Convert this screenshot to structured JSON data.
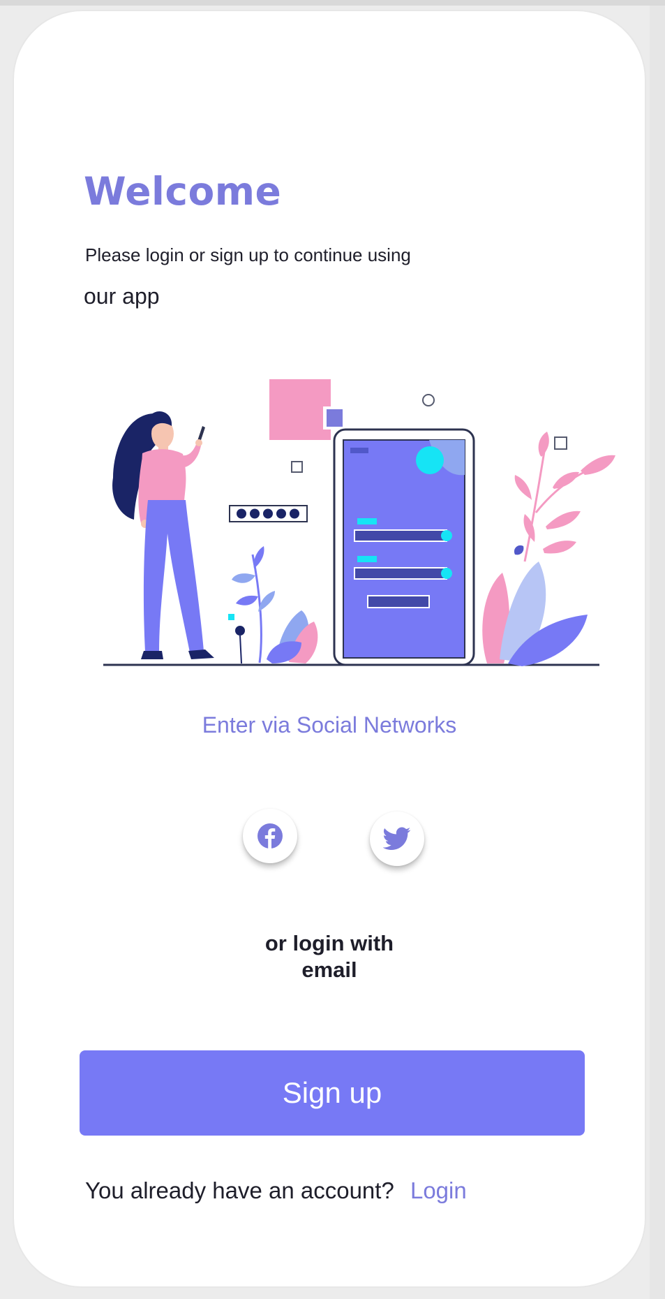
{
  "welcome": {
    "title": "Welcome",
    "subtitle_line1": "Please login or sign up to continue using",
    "subtitle_line2": "our app"
  },
  "social": {
    "heading": "Enter via Social Networks",
    "buttons": [
      {
        "icon": "facebook-icon"
      },
      {
        "icon": "twitter-icon"
      }
    ]
  },
  "email": {
    "or_line1": "or login with",
    "or_line2": "email"
  },
  "signup": {
    "label": "Sign up"
  },
  "footer": {
    "prompt": "You already have an account?",
    "login_label": "Login"
  },
  "colors": {
    "accent": "#7b7bdc",
    "button": "#7779f5",
    "pink": "#f49ac2",
    "cyan": "#16e4f5",
    "navy": "#1a2466"
  }
}
